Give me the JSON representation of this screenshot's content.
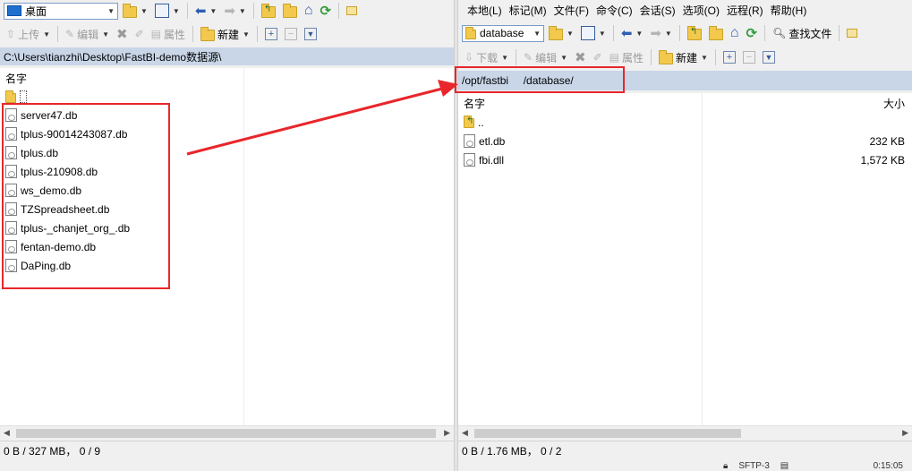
{
  "left": {
    "drive": "桌面",
    "toolbar": {
      "upload": "上传",
      "edit": "编辑",
      "properties": "属性",
      "new": "新建"
    },
    "path": "C:\\Users\\tianzhi\\Desktop\\FastBI-demo数据源\\",
    "column_name": "名字",
    "files": [
      {
        "name": "server47.db"
      },
      {
        "name": "tplus-90014243087.db"
      },
      {
        "name": "tplus.db"
      },
      {
        "name": "tplus-210908.db"
      },
      {
        "name": "ws_demo.db"
      },
      {
        "name": "TZSpreadsheet.db"
      },
      {
        "name": "tplus-_chanjet_org_.db"
      },
      {
        "name": "fentan-demo.db"
      },
      {
        "name": "DaPing.db"
      }
    ],
    "status": "0 B / 327 MB， 0 / 9"
  },
  "right": {
    "menu": [
      "本地(L)",
      "标记(M)",
      "文件(F)",
      "命令(C)",
      "会话(S)",
      "选项(O)",
      "远程(R)",
      "帮助(H)"
    ],
    "drive": "database",
    "toolbar": {
      "download": "下载",
      "edit": "编辑",
      "properties": "属性",
      "new": "新建",
      "find": "查找文件"
    },
    "path": "/opt/fastbi     /database/",
    "column_name": "名字",
    "column_size": "大小",
    "parent": "..",
    "files": [
      {
        "name": "etl.db",
        "size": "232 KB"
      },
      {
        "name": "fbi.dll",
        "size": "1,572 KB"
      }
    ],
    "status": "0 B / 1.76 MB， 0 / 2",
    "session": {
      "protocol": "SFTP-3",
      "time": "0:15:05"
    }
  },
  "colors": {
    "annotation": "#e8262b",
    "pathbar": "#c9d6e8"
  }
}
